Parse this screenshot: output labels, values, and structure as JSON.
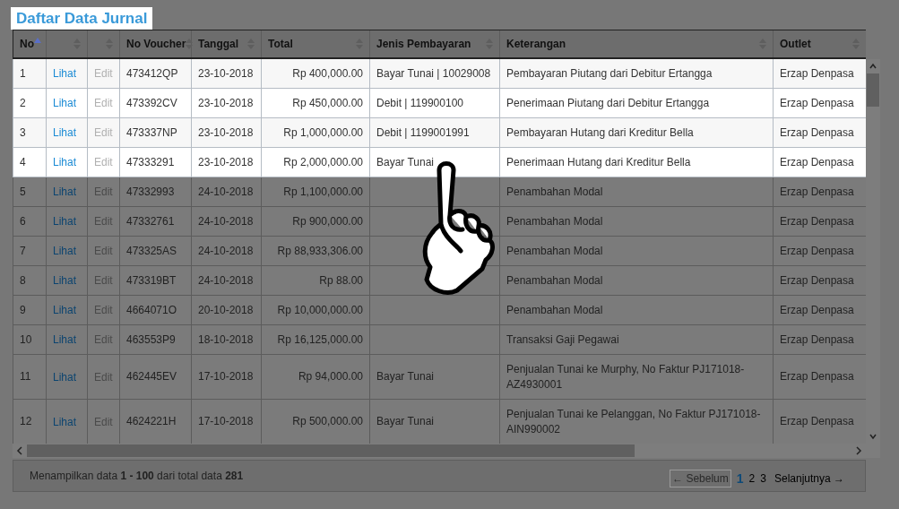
{
  "title": {
    "text": "Daftar Data Jurnal",
    "highlighted": true
  },
  "table": {
    "columns": [
      {
        "label": "No",
        "kind": "number",
        "sorted": true
      },
      {
        "kind": "link",
        "sorted": false
      },
      {
        "kind": "disabled-link",
        "sorted": false
      },
      {
        "label": "No Voucher",
        "kind": "text",
        "sorted": false
      },
      {
        "label": "Tanggal",
        "kind": "text",
        "sorted": false
      },
      {
        "label": "Total",
        "kind": "money",
        "sorted": false
      },
      {
        "label": "Jenis Pembayaran",
        "kind": "text",
        "sorted": false
      },
      {
        "label": "Keterangan",
        "kind": "text",
        "sorted": false
      },
      {
        "label": "Outlet",
        "kind": "text",
        "sorted": false
      }
    ],
    "rows": [
      {
        "highlighted": true,
        "tall": false,
        "cells": [
          "1",
          "Lihat",
          "Edit",
          "473412QP",
          "23-10-2018",
          "Rp 400,000.00",
          "Bayar Tunai | 10029008",
          "Pembayaran Piutang dari Debitur Ertangga",
          "Erzap Denpasa"
        ]
      },
      {
        "highlighted": true,
        "tall": false,
        "cells": [
          "2",
          "Lihat",
          "Edit",
          "473392CV",
          "23-10-2018",
          "Rp 450,000.00",
          "Debit | 119900100",
          "Penerimaan Piutang dari Debitur Ertangga",
          "Erzap Denpasa"
        ]
      },
      {
        "highlighted": true,
        "tall": false,
        "cells": [
          "3",
          "Lihat",
          "Edit",
          "473337NP",
          "23-10-2018",
          "Rp 1,000,000.00",
          "Debit | 1199001991",
          "Pembayaran Hutang dari Kreditur Bella",
          "Erzap Denpasa"
        ]
      },
      {
        "highlighted": true,
        "tall": false,
        "cells": [
          "4",
          "Lihat",
          "Edit",
          "47333291",
          "23-10-2018",
          "Rp 2,000,000.00",
          "Bayar Tunai",
          "Penerimaan Hutang dari Kreditur Bella",
          "Erzap Denpasa"
        ]
      },
      {
        "highlighted": false,
        "tall": false,
        "cells": [
          "5",
          "Lihat",
          "Edit",
          "47332993",
          "24-10-2018",
          "Rp 1,100,000.00",
          "",
          "Penambahan Modal",
          "Erzap Denpasa"
        ]
      },
      {
        "highlighted": false,
        "tall": false,
        "cells": [
          "6",
          "Lihat",
          "Edit",
          "47332761",
          "24-10-2018",
          "Rp 900,000.00",
          "",
          "Penambahan Modal",
          "Erzap Denpasa"
        ]
      },
      {
        "highlighted": false,
        "tall": false,
        "cells": [
          "7",
          "Lihat",
          "Edit",
          "473325AS",
          "24-10-2018",
          "Rp 88,933,306.00",
          "",
          "Penambahan Modal",
          "Erzap Denpasa"
        ]
      },
      {
        "highlighted": false,
        "tall": false,
        "cells": [
          "8",
          "Lihat",
          "Edit",
          "473319BT",
          "24-10-2018",
          "Rp 88.00",
          "",
          "Penambahan Modal",
          "Erzap Denpasa"
        ]
      },
      {
        "highlighted": false,
        "tall": false,
        "cells": [
          "9",
          "Lihat",
          "Edit",
          "4664071O",
          "20-10-2018",
          "Rp 10,000,000.00",
          "",
          "Penambahan Modal",
          "Erzap Denpasa"
        ]
      },
      {
        "highlighted": false,
        "tall": false,
        "cells": [
          "10",
          "Lihat",
          "Edit",
          "463553P9",
          "18-10-2018",
          "Rp 16,125,000.00",
          "",
          "Transaksi Gaji Pegawai",
          "Erzap Denpasa"
        ]
      },
      {
        "highlighted": false,
        "tall": true,
        "cells": [
          "11",
          "Lihat",
          "Edit",
          "462445EV",
          "17-10-2018",
          "Rp 94,000.00",
          "Bayar Tunai",
          "Penjualan Tunai ke Murphy, No Faktur PJ171018-AZ4930001",
          "Erzap Denpasa"
        ]
      },
      {
        "highlighted": false,
        "tall": true,
        "cells": [
          "12",
          "Lihat",
          "Edit",
          "4624221H",
          "17-10-2018",
          "Rp 500,000.00",
          "Bayar Tunai",
          "Penjualan Tunai ke Pelanggan, No Faktur PJ171018-AIN990002",
          "Erzap Denpasa"
        ]
      }
    ]
  },
  "footer": {
    "summary": "Menampilkan data **1 - 100** dari total data **281**",
    "previous": {
      "label": "← Sebelum",
      "disabled": true
    },
    "pages": [
      {
        "label": "1",
        "selected": true
      },
      {
        "label": "2",
        "selected": false
      },
      {
        "label": "3",
        "selected": false
      }
    ],
    "next": {
      "label": "Selanjutnya →",
      "disabled": false
    }
  }
}
